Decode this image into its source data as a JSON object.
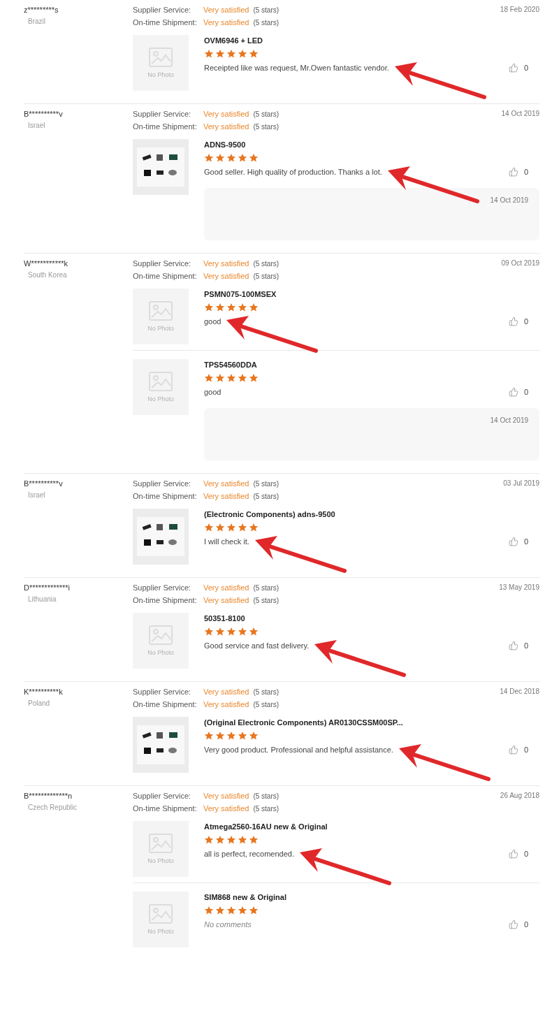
{
  "reviews": [
    {
      "buyer": "z*********s",
      "country": "Brazil",
      "date": "18 Feb 2020",
      "ratings": [
        {
          "label": "Supplier Service:",
          "value": "Very satisfied",
          "note": "(5 stars)"
        },
        {
          "label": "On-time Shipment:",
          "value": "Very satisfied",
          "note": "(5 stars)"
        }
      ],
      "products": [
        {
          "kind": "commented",
          "title": "OVM6946 + LED",
          "image": {
            "kind": "placeholder",
            "text": "No Photo"
          },
          "stars": 5,
          "comment": "Receipted like was request, Mr.Owen fantastic vendor.",
          "likes": "0",
          "arrow": true
        }
      ]
    },
    {
      "buyer": "B**********v",
      "country": "Israel",
      "date": "14 Oct 2019",
      "ratings": [
        {
          "label": "Supplier Service:",
          "value": "Very satisfied",
          "note": "(5 stars)"
        },
        {
          "label": "On-time Shipment:",
          "value": "Very satisfied",
          "note": "(5 stars)"
        }
      ],
      "products": [
        {
          "kind": "commented",
          "title": "ADNS-9500",
          "stars": 5,
          "comment": "Good seller. High quality of production. Thanks a lot.",
          "likes": "0",
          "arrow": true,
          "reply": {
            "date": "14 Oct 2019"
          }
        }
      ]
    },
    {
      "buyer": "W***********k",
      "country": "South Korea",
      "date": "09 Oct 2019",
      "ratings": [
        {
          "label": "Supplier Service:",
          "value": "Very satisfied",
          "note": "(5 stars)"
        },
        {
          "label": "On-time Shipment:",
          "value": "Very satisfied",
          "note": "(5 stars)"
        }
      ],
      "products": [
        {
          "kind": "commented",
          "title": "PSMN075-100MSEX",
          "image": {
            "kind": "placeholder",
            "text": "No Photo"
          },
          "stars": 5,
          "comment": "good",
          "likes": "0",
          "arrow": true
        },
        {
          "kind": "commented",
          "title": "TPS54560DDA",
          "image": {
            "kind": "placeholder",
            "text": "No Photo"
          },
          "stars": 5,
          "comment": "good",
          "likes": "0",
          "arrow": false,
          "reply": {
            "date": "14 Oct 2019"
          }
        }
      ]
    },
    {
      "buyer": "B**********v",
      "country": "Israel",
      "date": "03 Jul 2019",
      "ratings": [
        {
          "label": "Supplier Service:",
          "value": "Very satisfied",
          "note": "(5 stars)"
        },
        {
          "label": "On-time Shipment:",
          "value": "Very satisfied",
          "note": "(5 stars)"
        }
      ],
      "products": [
        {
          "kind": "commented",
          "title": "(Electronic Components) adns-9500",
          "stars": 5,
          "comment": "I will check it.",
          "likes": "0",
          "arrow": true
        }
      ]
    },
    {
      "buyer": "D*************i",
      "country": "Lithuania",
      "date": "13 May 2019",
      "ratings": [
        {
          "label": "Supplier Service:",
          "value": "Very satisfied",
          "note": "(5 stars)"
        },
        {
          "label": "On-time Shipment:",
          "value": "Very satisfied",
          "note": "(5 stars)"
        }
      ],
      "products": [
        {
          "kind": "commented",
          "title": "50351-8100",
          "image": {
            "kind": "placeholder",
            "text": "No Photo"
          },
          "stars": 5,
          "comment": "Good service and fast delivery.",
          "likes": "0",
          "arrow": true
        }
      ]
    },
    {
      "buyer": "K**********k",
      "country": "Poland",
      "date": "14 Dec 2018",
      "ratings": [
        {
          "label": "Supplier Service:",
          "value": "Very satisfied",
          "note": "(5 stars)"
        },
        {
          "label": "On-time Shipment:",
          "value": "Very satisfied",
          "note": "(5 stars)"
        }
      ],
      "products": [
        {
          "kind": "commented",
          "title": "(Original Electronic Components) AR0130CSSM00SP...",
          "stars": 5,
          "comment": "Very good product. Professional and helpful assistance.",
          "likes": "0",
          "arrow": true
        }
      ]
    },
    {
      "buyer": "B*************n",
      "country": "Czech Republic",
      "date": "26 Aug 2018",
      "ratings": [
        {
          "label": "Supplier Service:",
          "value": "Very satisfied",
          "note": "(5 stars)"
        },
        {
          "label": "On-time Shipment:",
          "value": "Very satisfied",
          "note": "(5 stars)"
        }
      ],
      "products": [
        {
          "kind": "commented",
          "title": "Atmega2560-16AU new & Original",
          "image": {
            "kind": "placeholder",
            "text": "No Photo"
          },
          "stars": 5,
          "comment": "all is perfect, recomended.",
          "likes": "0",
          "arrow": true
        },
        {
          "kind": "empty",
          "title": "SIM868 new & Original",
          "image": {
            "kind": "placeholder",
            "text": "No Photo"
          },
          "stars": 5,
          "comment": "No comments",
          "likes": "0",
          "arrow": false
        }
      ]
    }
  ]
}
